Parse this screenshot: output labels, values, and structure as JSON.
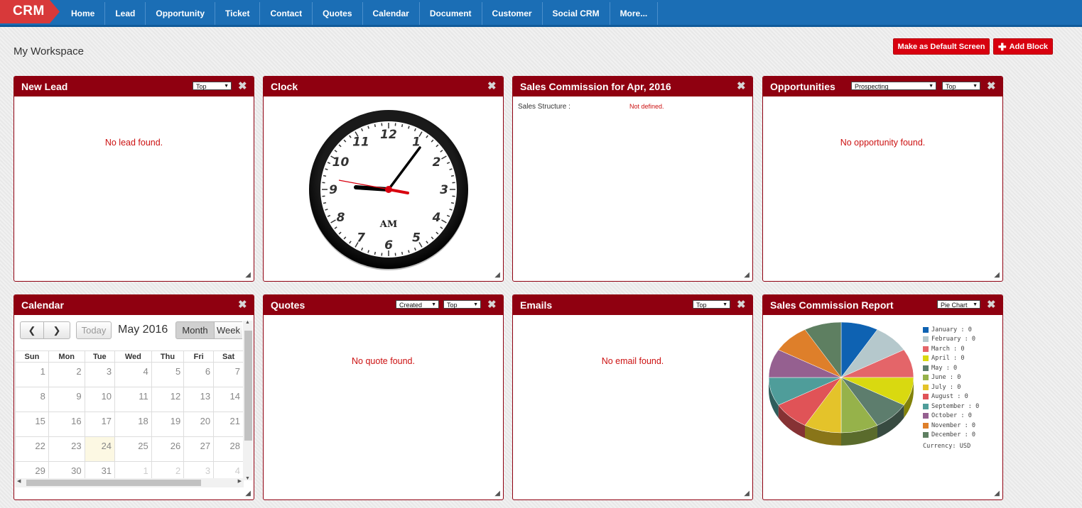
{
  "app": {
    "logo": "CRM"
  },
  "nav": [
    "Home",
    "Lead",
    "Opportunity",
    "Ticket",
    "Contact",
    "Quotes",
    "Calendar",
    "Document",
    "Customer",
    "Social CRM",
    "More..."
  ],
  "workspace": {
    "title": "My Workspace",
    "default_button": "Make as Default Screen",
    "add_block_button": "Add Block"
  },
  "panels": {
    "new_lead": {
      "title": "New Lead",
      "select": "Top",
      "empty": "No lead found."
    },
    "clock": {
      "title": "Clock",
      "meridiem": "AM",
      "numbers": [
        "12",
        "1",
        "2",
        "3",
        "4",
        "5",
        "6",
        "7",
        "8",
        "9",
        "10",
        "11"
      ]
    },
    "sales_commission": {
      "title": "Sales Commission for Apr, 2016",
      "label": "Sales Structure :",
      "value": "Not defined."
    },
    "opportunities": {
      "title": "Opportunities",
      "select_stage": "Prospecting",
      "select_top": "Top",
      "empty": "No opportunity found."
    },
    "calendar": {
      "title": "Calendar",
      "today_button": "Today",
      "month_label": "May 2016",
      "view_month": "Month",
      "view_week": "Week",
      "days": [
        "Sun",
        "Mon",
        "Tue",
        "Wed",
        "Thu",
        "Fri",
        "Sat"
      ],
      "weeks": [
        [
          "1",
          "2",
          "3",
          "4",
          "5",
          "6",
          "7"
        ],
        [
          "8",
          "9",
          "10",
          "11",
          "12",
          "13",
          "14"
        ],
        [
          "15",
          "16",
          "17",
          "18",
          "19",
          "20",
          "21"
        ],
        [
          "22",
          "23",
          "24",
          "25",
          "26",
          "27",
          "28"
        ],
        [
          "29",
          "30",
          "31",
          "1",
          "2",
          "3",
          "4"
        ]
      ]
    },
    "quotes": {
      "title": "Quotes",
      "select_created": "Created",
      "select_top": "Top",
      "empty": "No quote found."
    },
    "emails": {
      "title": "Emails",
      "select": "Top",
      "empty": "No email found."
    },
    "sales_report": {
      "title": "Sales Commission Report",
      "select": "Pie Chart",
      "currency": "Currency: USD"
    }
  },
  "chart_data": {
    "type": "pie",
    "categories": [
      "January",
      "February",
      "March",
      "April",
      "May",
      "June",
      "July",
      "August",
      "September",
      "October",
      "November",
      "December"
    ],
    "values": [
      0,
      0,
      0,
      0,
      0,
      0,
      0,
      0,
      0,
      0,
      0,
      0
    ],
    "legend_labels": [
      "January : 0",
      "February : 0",
      "March : 0",
      "April : 0",
      "May : 0",
      "June : 0",
      "July : 0",
      "August : 0",
      "September : 0",
      "October : 0",
      "November : 0",
      "December : 0"
    ],
    "colors": [
      "#0e62b2",
      "#b5c8cc",
      "#e46569",
      "#d9d910",
      "#5d7d6d",
      "#96b24a",
      "#e4c32a",
      "#e05357",
      "#4f9d9a",
      "#956090",
      "#de7f2a",
      "#5e7f61"
    ],
    "legend_position": "right"
  }
}
